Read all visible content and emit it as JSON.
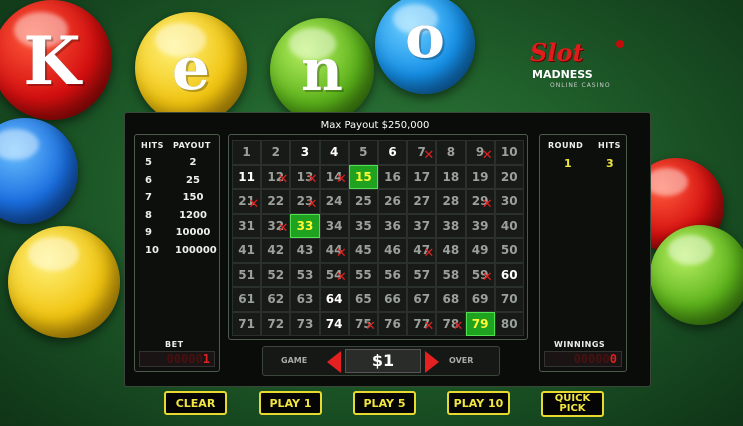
{
  "title_letters": [
    "K",
    "e",
    "n",
    "o"
  ],
  "logo": {
    "line1": "Slot",
    "line2": "MADNESS",
    "line3": "ONLINE CASINO"
  },
  "max_payout": "Max Payout $250,000",
  "paytable": {
    "header_hits": "HITS",
    "header_payout": "PAYOUT",
    "rows": [
      {
        "hits": "5",
        "payout": "2"
      },
      {
        "hits": "6",
        "payout": "25"
      },
      {
        "hits": "7",
        "payout": "150"
      },
      {
        "hits": "8",
        "payout": "1200"
      },
      {
        "hits": "9",
        "payout": "10000"
      },
      {
        "hits": "10",
        "payout": "100000"
      }
    ]
  },
  "bet": {
    "label": "BET",
    "value": "000001"
  },
  "winnings": {
    "label": "WINNINGS",
    "value": "000000"
  },
  "round": {
    "header_round": "ROUND",
    "header_hits": "HITS",
    "round_value": "1",
    "hits_value": "3"
  },
  "game_bar": {
    "left_label": "GAME",
    "amount": "$1",
    "right_label": "OVER"
  },
  "board": {
    "numbers": [
      "1",
      "2",
      "3",
      "4",
      "5",
      "6",
      "7",
      "8",
      "9",
      "10",
      "11",
      "12",
      "13",
      "14",
      "15",
      "16",
      "17",
      "18",
      "19",
      "20",
      "21",
      "22",
      "23",
      "24",
      "25",
      "26",
      "27",
      "28",
      "29",
      "30",
      "31",
      "32",
      "33",
      "34",
      "35",
      "36",
      "37",
      "38",
      "39",
      "40",
      "41",
      "42",
      "43",
      "44",
      "45",
      "46",
      "47",
      "48",
      "49",
      "50",
      "51",
      "52",
      "53",
      "54",
      "55",
      "56",
      "57",
      "58",
      "59",
      "60",
      "61",
      "62",
      "63",
      "64",
      "65",
      "66",
      "67",
      "68",
      "69",
      "70",
      "71",
      "72",
      "73",
      "74",
      "75",
      "76",
      "77",
      "78",
      "79",
      "80"
    ],
    "picked": [
      3,
      4,
      6,
      11,
      15,
      33,
      60,
      64,
      74,
      79
    ],
    "drawn": [
      7,
      9,
      12,
      13,
      14,
      21,
      23,
      29,
      32,
      44,
      47,
      54,
      59,
      75,
      77,
      78,
      15,
      33,
      79
    ],
    "hits": [
      15,
      33,
      79
    ]
  },
  "buttons": {
    "clear": "CLEAR",
    "play1": "PLAY 1",
    "play5": "PLAY 5",
    "play10": "PLAY 10",
    "quick_pick": "QUICK PICK"
  },
  "colors": {
    "hit_green": "#1fa21f",
    "button_yellow": "#f1e640",
    "digit_red": "#e02020"
  }
}
